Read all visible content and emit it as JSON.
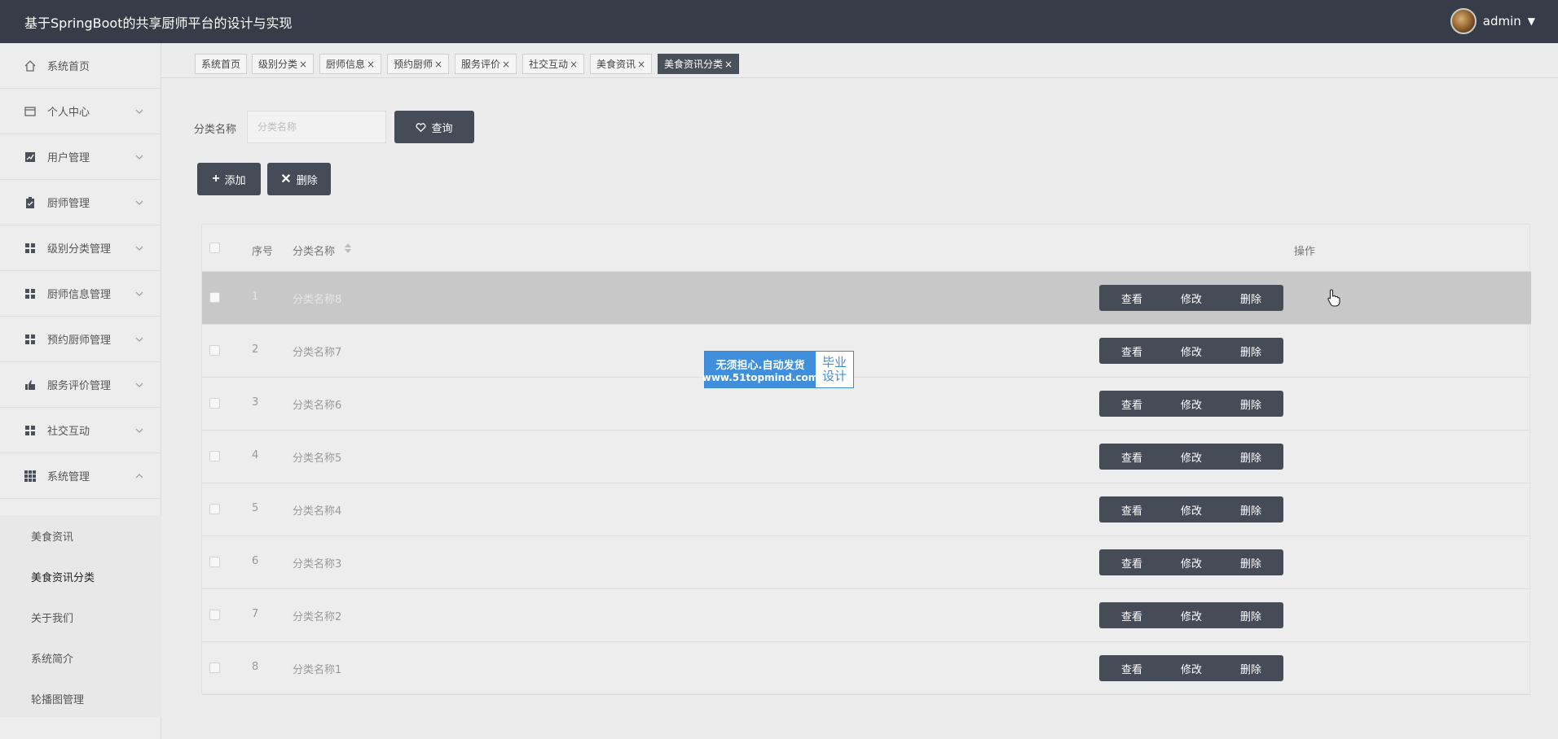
{
  "header": {
    "title": "基于SpringBoot的共享厨师平台的设计与实现",
    "username": "admin"
  },
  "sidebar": {
    "items": [
      {
        "label": "系统首页",
        "icon": "home-icon"
      },
      {
        "label": "个人中心",
        "icon": "card-icon"
      },
      {
        "label": "用户管理",
        "icon": "chart-icon"
      },
      {
        "label": "厨师管理",
        "icon": "clipboard-icon"
      },
      {
        "label": "级别分类管理",
        "icon": "grid-icon"
      },
      {
        "label": "厨师信息管理",
        "icon": "grid-icon"
      },
      {
        "label": "预约厨师管理",
        "icon": "grid-icon"
      },
      {
        "label": "服务评价管理",
        "icon": "thumb-icon"
      },
      {
        "label": "社交互动",
        "icon": "grid-icon"
      },
      {
        "label": "系统管理",
        "icon": "apps-icon"
      }
    ],
    "sub_items": [
      {
        "label": "美食资讯"
      },
      {
        "label": "美食资讯分类"
      },
      {
        "label": "关于我们"
      },
      {
        "label": "系统简介"
      },
      {
        "label": "轮播图管理"
      }
    ]
  },
  "tabs": [
    {
      "label": "系统首页",
      "close": ""
    },
    {
      "label": "级别分类",
      "close": "×"
    },
    {
      "label": "厨师信息",
      "close": "×"
    },
    {
      "label": "预约厨师",
      "close": "×"
    },
    {
      "label": "服务评价",
      "close": "×"
    },
    {
      "label": "社交互动",
      "close": "×"
    },
    {
      "label": "美食资讯",
      "close": "×"
    },
    {
      "label": "美食资讯分类",
      "close": "×"
    }
  ],
  "search": {
    "label": "分类名称",
    "placeholder": "分类名称",
    "query_button": "查询"
  },
  "toolbar": {
    "add_label": "添加",
    "delete_label": "删除"
  },
  "table": {
    "columns": {
      "index": "序号",
      "name": "分类名称",
      "actions": "操作"
    },
    "rows": [
      {
        "index": "1",
        "name": "分类名称8"
      },
      {
        "index": "2",
        "name": "分类名称7"
      },
      {
        "index": "3",
        "name": "分类名称6"
      },
      {
        "index": "4",
        "name": "分类名称5"
      },
      {
        "index": "5",
        "name": "分类名称4"
      },
      {
        "index": "6",
        "name": "分类名称3"
      },
      {
        "index": "7",
        "name": "分类名称2"
      },
      {
        "index": "8",
        "name": "分类名称1"
      }
    ],
    "actions": {
      "view": "查看",
      "edit": "修改",
      "delete": "删除"
    }
  },
  "watermark": {
    "line1": "无须担心.自动发货",
    "line2": "www.51topmind.com",
    "badge1": "毕业",
    "badge2": "设计"
  },
  "colors": {
    "header_bg": "#363d48",
    "button_bg": "#454c57",
    "watermark_blue": "#3f8fdc"
  }
}
